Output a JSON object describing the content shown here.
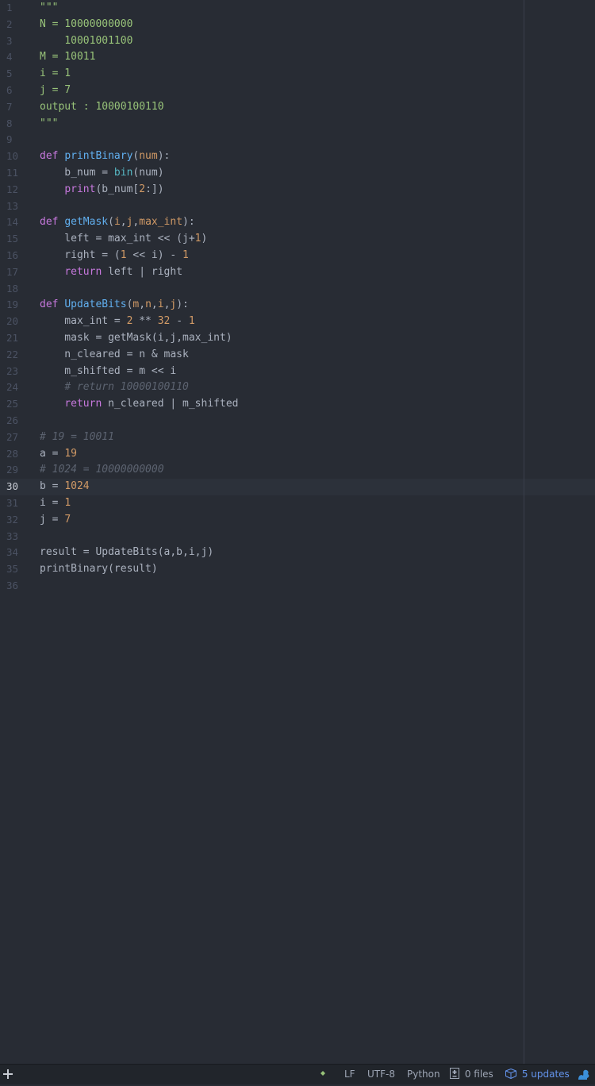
{
  "editor": {
    "language": "Python",
    "cursor_line": 30,
    "lines": [
      [
        {
          "t": "\"\"\"",
          "c": "str"
        }
      ],
      [
        {
          "t": "N = 10000000000",
          "c": "str"
        }
      ],
      [
        {
          "t": "    10001001100",
          "c": "str"
        }
      ],
      [
        {
          "t": "M = 10011",
          "c": "str"
        }
      ],
      [
        {
          "t": "i = 1",
          "c": "str"
        }
      ],
      [
        {
          "t": "j = 7",
          "c": "str"
        }
      ],
      [
        {
          "t": "output : 10000100110",
          "c": "str"
        }
      ],
      [
        {
          "t": "\"\"\"",
          "c": "str"
        }
      ],
      [],
      [
        {
          "t": "def",
          "c": "kw"
        },
        {
          "t": " "
        },
        {
          "t": "printBinary",
          "c": "fn"
        },
        {
          "t": "("
        },
        {
          "t": "num",
          "c": "param"
        },
        {
          "t": "):"
        }
      ],
      [
        {
          "t": "    b_num = "
        },
        {
          "t": "bin",
          "c": "bi"
        },
        {
          "t": "(num)"
        }
      ],
      [
        {
          "t": "    "
        },
        {
          "t": "print",
          "c": "kw"
        },
        {
          "t": "(b_num["
        },
        {
          "t": "2",
          "c": "num"
        },
        {
          "t": ":])"
        }
      ],
      [],
      [
        {
          "t": "def",
          "c": "kw"
        },
        {
          "t": " "
        },
        {
          "t": "getMask",
          "c": "fn"
        },
        {
          "t": "("
        },
        {
          "t": "i",
          "c": "param"
        },
        {
          "t": ","
        },
        {
          "t": "j",
          "c": "param"
        },
        {
          "t": ","
        },
        {
          "t": "max_int",
          "c": "param"
        },
        {
          "t": "):"
        }
      ],
      [
        {
          "t": "    left = max_int << (j+"
        },
        {
          "t": "1",
          "c": "num"
        },
        {
          "t": ")"
        }
      ],
      [
        {
          "t": "    right = ("
        },
        {
          "t": "1",
          "c": "num"
        },
        {
          "t": " << i) - "
        },
        {
          "t": "1",
          "c": "num"
        }
      ],
      [
        {
          "t": "    "
        },
        {
          "t": "return",
          "c": "kw"
        },
        {
          "t": " left | right"
        }
      ],
      [],
      [
        {
          "t": "def",
          "c": "kw"
        },
        {
          "t": " "
        },
        {
          "t": "UpdateBits",
          "c": "fn"
        },
        {
          "t": "("
        },
        {
          "t": "m",
          "c": "param"
        },
        {
          "t": ","
        },
        {
          "t": "n",
          "c": "param"
        },
        {
          "t": ","
        },
        {
          "t": "i",
          "c": "param"
        },
        {
          "t": ","
        },
        {
          "t": "j",
          "c": "param"
        },
        {
          "t": "):"
        }
      ],
      [
        {
          "t": "    max_int = "
        },
        {
          "t": "2",
          "c": "num"
        },
        {
          "t": " ** "
        },
        {
          "t": "32",
          "c": "num"
        },
        {
          "t": " - "
        },
        {
          "t": "1",
          "c": "num"
        }
      ],
      [
        {
          "t": "    mask = getMask(i,j,max_int)"
        }
      ],
      [
        {
          "t": "    n_cleared = n & mask"
        }
      ],
      [
        {
          "t": "    m_shifted = m << i"
        }
      ],
      [
        {
          "t": "    "
        },
        {
          "t": "# return 10000100110",
          "c": "cmt"
        }
      ],
      [
        {
          "t": "    "
        },
        {
          "t": "return",
          "c": "kw"
        },
        {
          "t": " n_cleared | m_shifted"
        }
      ],
      [],
      [
        {
          "t": "# 19 = 10011",
          "c": "cmt"
        }
      ],
      [
        {
          "t": "a = "
        },
        {
          "t": "19",
          "c": "num"
        }
      ],
      [
        {
          "t": "# 1024 = 10000000000",
          "c": "cmt"
        }
      ],
      [
        {
          "t": "b = "
        },
        {
          "t": "1024",
          "c": "num"
        }
      ],
      [
        {
          "t": "i = "
        },
        {
          "t": "1",
          "c": "num"
        }
      ],
      [
        {
          "t": "j = "
        },
        {
          "t": "7",
          "c": "num"
        }
      ],
      [],
      [
        {
          "t": "result = UpdateBits(a,b,i,j)"
        }
      ],
      [
        {
          "t": "printBinary(result)"
        }
      ],
      []
    ]
  },
  "status_bar": {
    "add_icon": "plus-icon",
    "git_icon": "diamond-dot-icon",
    "line_ending": "LF",
    "encoding": "UTF-8",
    "grammar": "Python",
    "files_icon": "file-diff-icon",
    "files_label": "0 files",
    "updates_icon": "package-icon",
    "updates_label": "5 updates",
    "bird_icon": "squirrel-icon",
    "updates_color": "#6494ed"
  }
}
